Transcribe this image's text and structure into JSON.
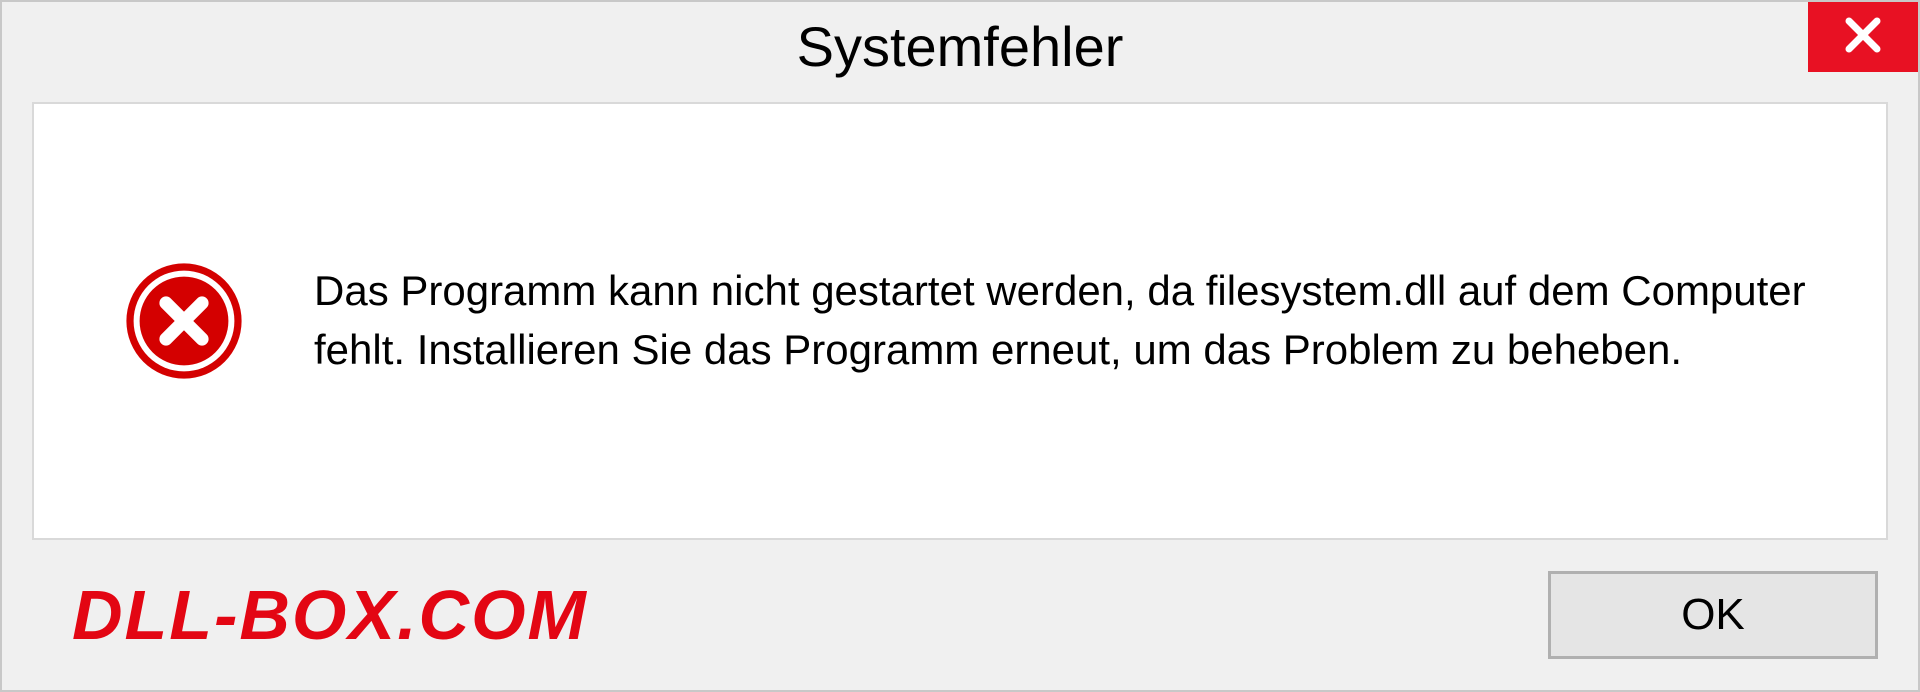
{
  "dialog": {
    "title": "Systemfehler",
    "message": "Das Programm kann nicht gestartet werden, da filesystem.dll auf dem Computer fehlt. Installieren Sie das Programm erneut, um das Problem zu beheben.",
    "ok_label": "OK"
  },
  "watermark": "DLL-BOX.COM"
}
